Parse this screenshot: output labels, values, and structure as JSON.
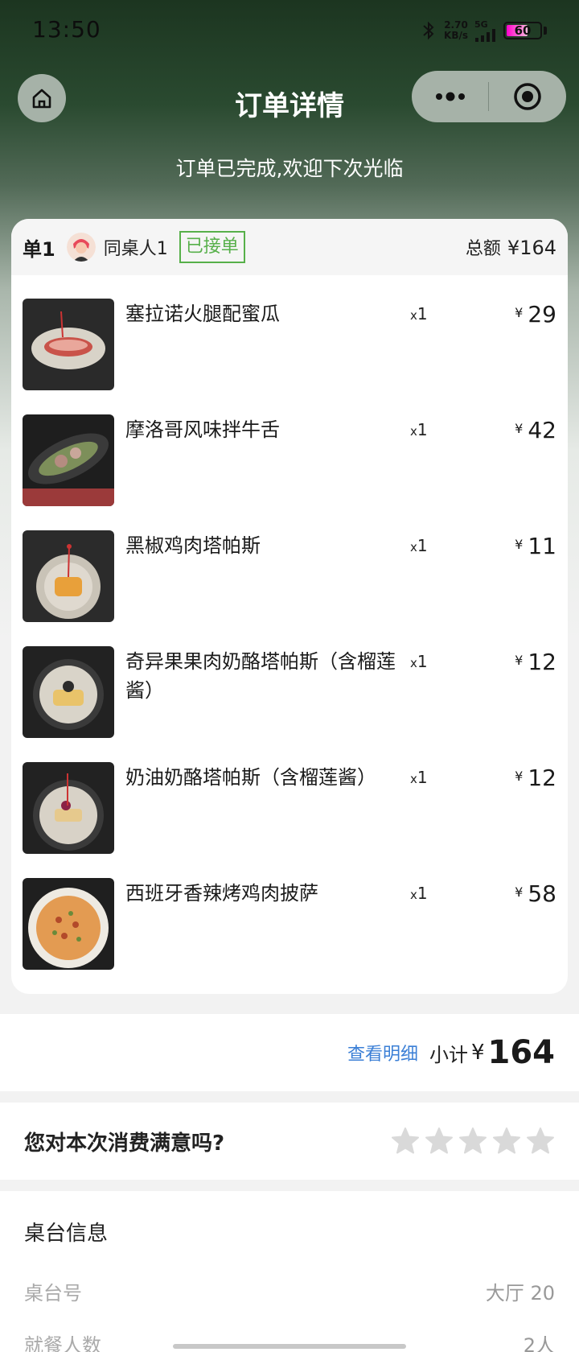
{
  "status_bar": {
    "time": "13:50",
    "net_speed_value": "2.70",
    "net_speed_unit": "KB/s",
    "network": "5G",
    "battery": "60"
  },
  "nav": {
    "title": "订单详情"
  },
  "order_status": "订单已完成,欢迎下次光临",
  "order": {
    "order_no": "单1",
    "owner": "同桌人1",
    "status_badge": "已接单",
    "total_label": "总额",
    "total_amount": "¥164",
    "items": [
      {
        "name": "塞拉诺火腿配蜜瓜",
        "qty_prefix": "x",
        "qty": "1",
        "yen": "¥",
        "price": "29"
      },
      {
        "name": "摩洛哥风味拌牛舌",
        "qty_prefix": "x",
        "qty": "1",
        "yen": "¥",
        "price": "42"
      },
      {
        "name": "黑椒鸡肉塔帕斯",
        "qty_prefix": "x",
        "qty": "1",
        "yen": "¥",
        "price": "11"
      },
      {
        "name": "奇异果果肉奶酪塔帕斯（含榴莲酱）",
        "qty_prefix": "x",
        "qty": "1",
        "yen": "¥",
        "price": "12"
      },
      {
        "name": "奶油奶酪塔帕斯（含榴莲酱）",
        "qty_prefix": "x",
        "qty": "1",
        "yen": "¥",
        "price": "12"
      },
      {
        "name": "西班牙香辣烤鸡肉披萨",
        "qty_prefix": "x",
        "qty": "1",
        "yen": "¥",
        "price": "58"
      }
    ]
  },
  "subtotal": {
    "detail_link": "查看明细",
    "label": "小计",
    "yen": "¥",
    "value": "164"
  },
  "rating": {
    "question": "您对本次消费满意吗?",
    "stars": 5,
    "selected": 0
  },
  "table_info": {
    "title": "桌台信息",
    "rows": [
      {
        "label": "桌台号",
        "value": "大厅 20"
      },
      {
        "label": "就餐人数",
        "value": "2人"
      }
    ]
  },
  "colors": {
    "accent_green": "#57b04a",
    "link_blue": "#3b7fd6",
    "header_green": "#1c3520"
  }
}
